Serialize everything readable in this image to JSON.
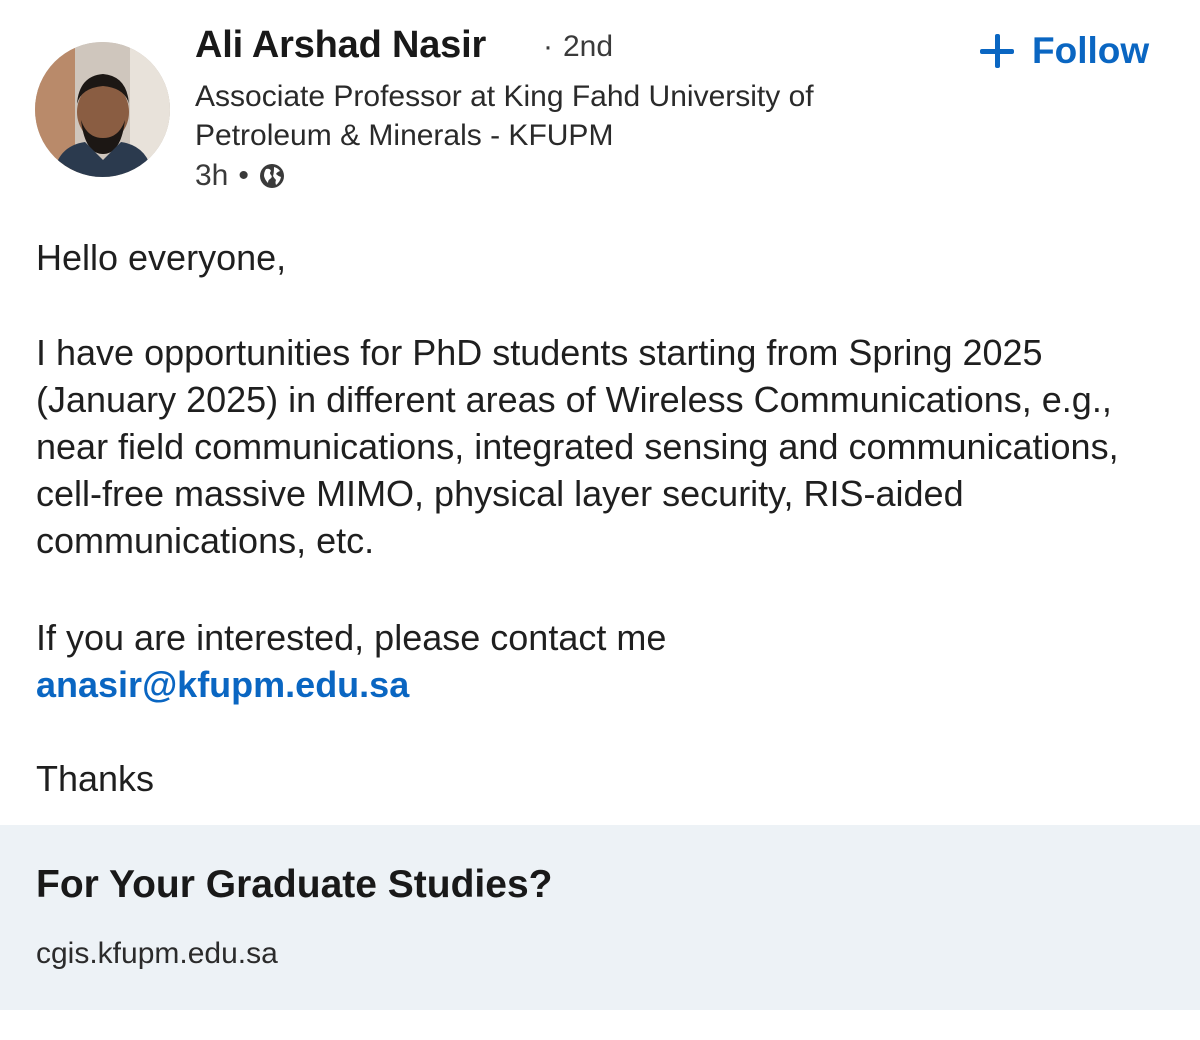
{
  "author": {
    "name": "Ali Arshad Nasir",
    "separator": "·",
    "degree": "2nd",
    "headline": "Associate Professor at King Fahd University of Petroleum & Minerals - KFUPM",
    "timestamp": "3h",
    "meta_separator": "•",
    "visibility_icon": "globe-icon",
    "avatar_icon": "profile-photo"
  },
  "actions": {
    "follow_icon": "plus-icon",
    "follow_label": "Follow",
    "accent_color": "#0a66c2"
  },
  "post": {
    "greeting": "Hello everyone,",
    "paragraph": "I have opportunities for PhD students starting from Spring 2025 (January 2025) in different areas of Wireless Communications, e.g., near field communications, integrated sensing and communications, cell-free massive MIMO, physical layer security, RIS-aided communications, etc.",
    "contact_text": "If you are interested, please contact me",
    "email": "anasir@kfupm.edu.sa",
    "closing": "Thanks"
  },
  "link_preview": {
    "title": "For Your Graduate Studies?",
    "domain": "cgis.kfupm.edu.sa",
    "background": "#edf2f6"
  }
}
